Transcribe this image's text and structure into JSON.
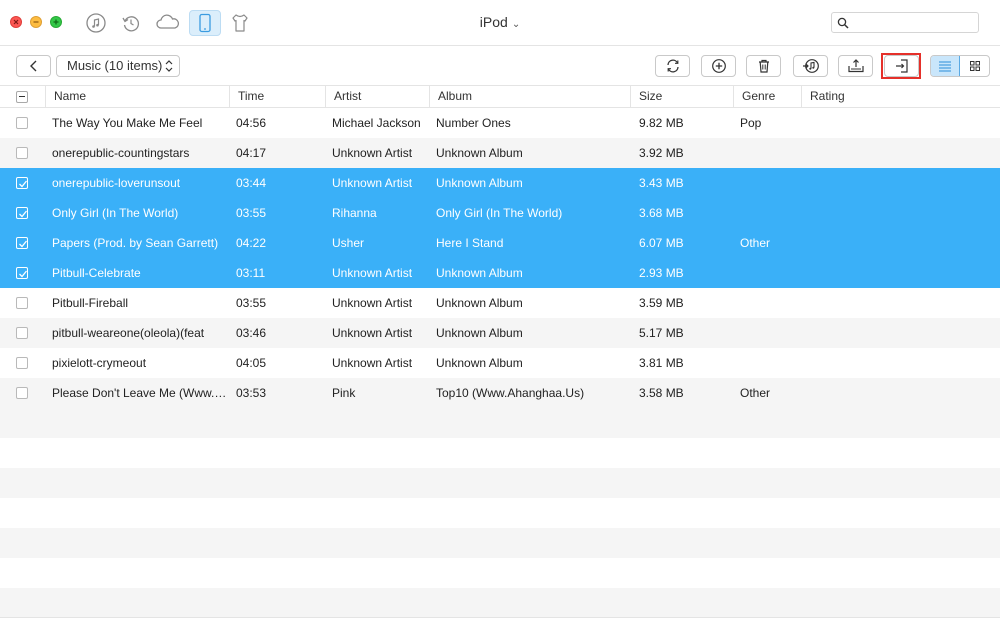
{
  "window": {
    "device_title": "iPod",
    "device_caret": "⌄",
    "nav_icons": [
      "itunes-library-icon",
      "backup-restore-icon",
      "icloud-icon",
      "device-icon",
      "app-store-icon"
    ]
  },
  "search": {
    "placeholder": "",
    "value": ""
  },
  "toolbar": {
    "category_label": "Music (10 items)",
    "buttons": [
      "refresh-icon",
      "add-icon",
      "delete-icon",
      "to-itunes-icon",
      "to-device-icon",
      "to-computer-icon"
    ],
    "view_modes": [
      "list-view-icon",
      "grid-view-icon"
    ],
    "active_view": "list"
  },
  "table": {
    "columns": [
      "Name",
      "Time",
      "Artist",
      "Album",
      "Size",
      "Genre",
      "Rating"
    ],
    "rows": [
      {
        "name": "The Way You Make Me Feel",
        "time": "04:56",
        "artist": "Michael Jackson",
        "album": "Number Ones",
        "size": "9.82 MB",
        "genre": "Pop",
        "rating": "",
        "checked": false
      },
      {
        "name": "onerepublic-countingstars",
        "time": "04:17",
        "artist": "Unknown Artist",
        "album": "Unknown Album",
        "size": "3.92 MB",
        "genre": "",
        "rating": "",
        "checked": false
      },
      {
        "name": "onerepublic-loverunsout",
        "time": "03:44",
        "artist": "Unknown Artist",
        "album": "Unknown Album",
        "size": "3.43 MB",
        "genre": "",
        "rating": "",
        "checked": true
      },
      {
        "name": "Only Girl (In The World)",
        "time": "03:55",
        "artist": "Rihanna",
        "album": "Only Girl (In The World)",
        "size": "3.68 MB",
        "genre": "",
        "rating": "",
        "checked": true
      },
      {
        "name": "Papers (Prod. by Sean Garrett)",
        "time": "04:22",
        "artist": "Usher",
        "album": "Here I Stand",
        "size": "6.07 MB",
        "genre": "Other",
        "rating": "",
        "checked": true
      },
      {
        "name": "Pitbull-Celebrate",
        "time": "03:11",
        "artist": "Unknown Artist",
        "album": "Unknown Album",
        "size": "2.93 MB",
        "genre": "",
        "rating": "",
        "checked": true
      },
      {
        "name": "Pitbull-Fireball",
        "time": "03:55",
        "artist": "Unknown Artist",
        "album": "Unknown Album",
        "size": "3.59 MB",
        "genre": "",
        "rating": "",
        "checked": false
      },
      {
        "name": "pitbull-weareone(oleola)(feat",
        "time": "03:46",
        "artist": "Unknown Artist",
        "album": "Unknown Album",
        "size": "5.17 MB",
        "genre": "",
        "rating": "",
        "checked": false
      },
      {
        "name": "pixielott-crymeout",
        "time": "04:05",
        "artist": "Unknown Artist",
        "album": "Unknown Album",
        "size": "3.81 MB",
        "genre": "",
        "rating": "",
        "checked": false
      },
      {
        "name": "Please Don't Leave Me (Www.…",
        "time": "03:53",
        "artist": "Pink",
        "album": "Top10 (Www.Ahanghaa.Us)",
        "size": "3.58 MB",
        "genre": "Other",
        "rating": "",
        "checked": false
      }
    ]
  },
  "colors": {
    "selection": "#3ab0f8",
    "alt_row": "#f5f5f5",
    "highlight_box": "#e5302a",
    "close": "#fc5753",
    "minimize": "#fdbc40",
    "zoom": "#33c748"
  }
}
